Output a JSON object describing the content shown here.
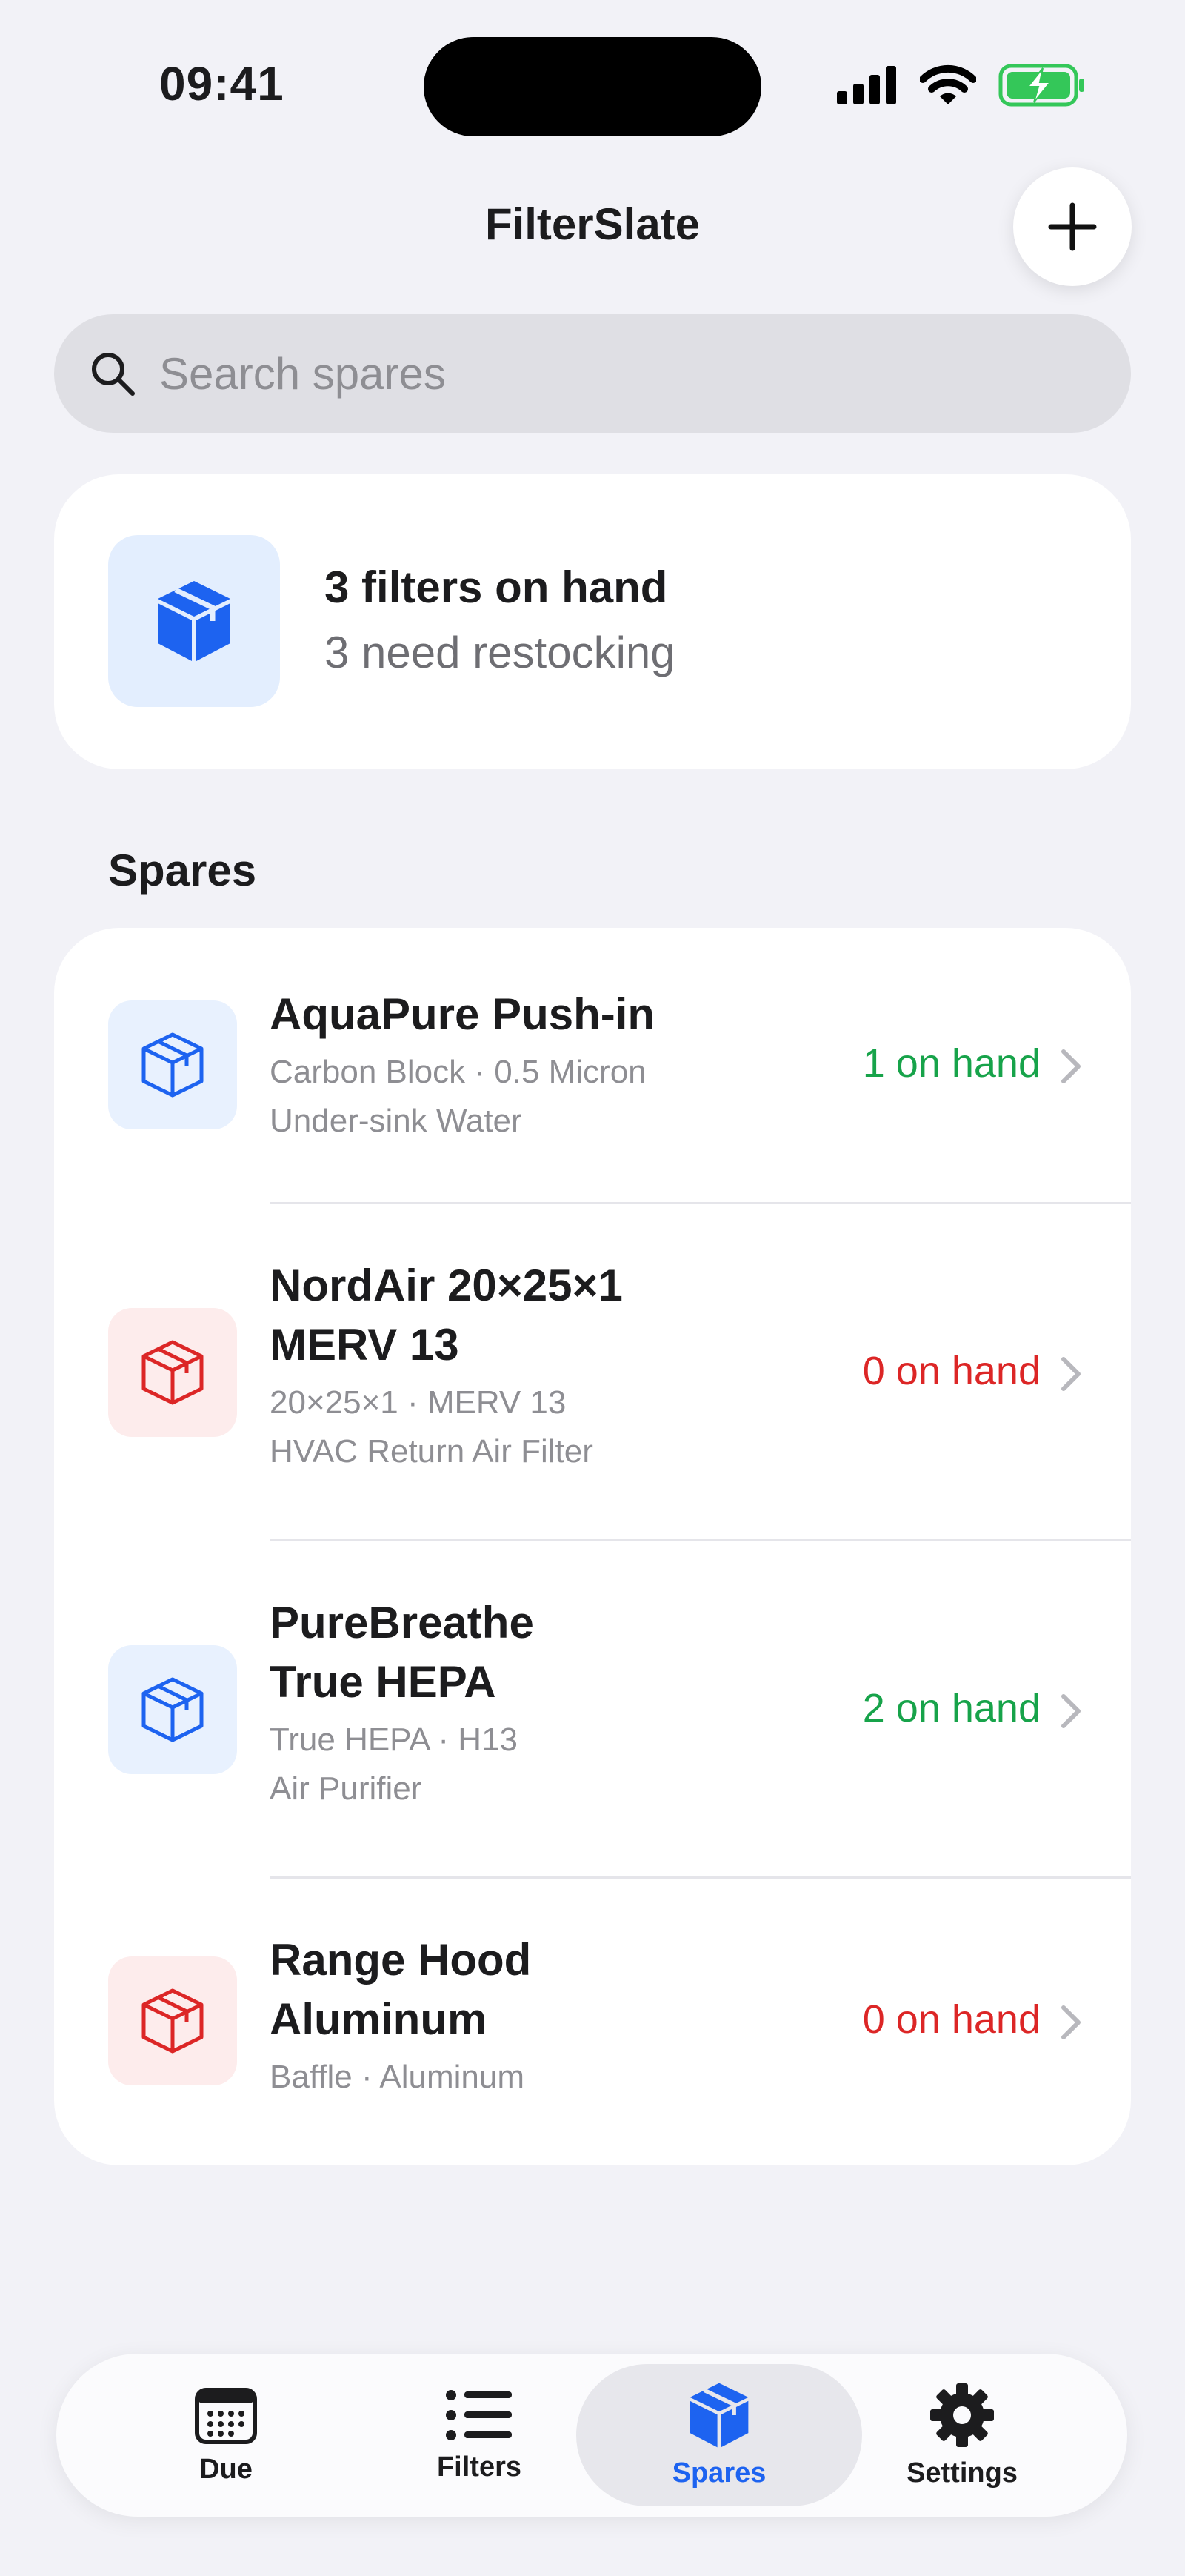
{
  "status_bar": {
    "time": "09:41"
  },
  "header": {
    "title": "FilterSlate"
  },
  "search": {
    "placeholder": "Search spares"
  },
  "summary": {
    "title": "3 filters on hand",
    "subtitle": "3 need restocking"
  },
  "section": {
    "title": "Spares"
  },
  "spares": [
    {
      "name_lines": [
        "AquaPure Push-in"
      ],
      "meta_lines": [
        "Carbon Block · 0.5 Micron",
        "Under-sink Water"
      ],
      "quantity": "1 on hand",
      "status": "in-stock",
      "icon": "box-icon"
    },
    {
      "name_lines": [
        "NordAir 20×25×1",
        "MERV 13"
      ],
      "meta_lines": [
        "20×25×1 · MERV 13",
        "HVAC Return Air Filter"
      ],
      "quantity": "0 on hand",
      "status": "out-of-stock",
      "icon": "box-icon"
    },
    {
      "name_lines": [
        "PureBreathe",
        "True HEPA"
      ],
      "meta_lines": [
        "True HEPA · H13",
        "Air Purifier"
      ],
      "quantity": "2 on hand",
      "status": "in-stock",
      "icon": "box-icon"
    },
    {
      "name_lines": [
        "Range Hood",
        "Aluminum"
      ],
      "meta_lines": [
        "Baffle · Aluminum"
      ],
      "quantity": "0 on hand",
      "status": "out-of-stock",
      "icon": "box-icon"
    }
  ],
  "tabs": [
    {
      "label": "Due",
      "icon": "calendar-icon",
      "active": false
    },
    {
      "label": "Filters",
      "icon": "list-icon",
      "active": false
    },
    {
      "label": "Spares",
      "icon": "box-icon",
      "active": true
    },
    {
      "label": "Settings",
      "icon": "gear-icon",
      "active": false
    }
  ],
  "colors": {
    "accent": "#1d63f0",
    "in_stock": "#17a34a",
    "out_of_stock": "#dc2626",
    "background": "#f2f2f7"
  }
}
